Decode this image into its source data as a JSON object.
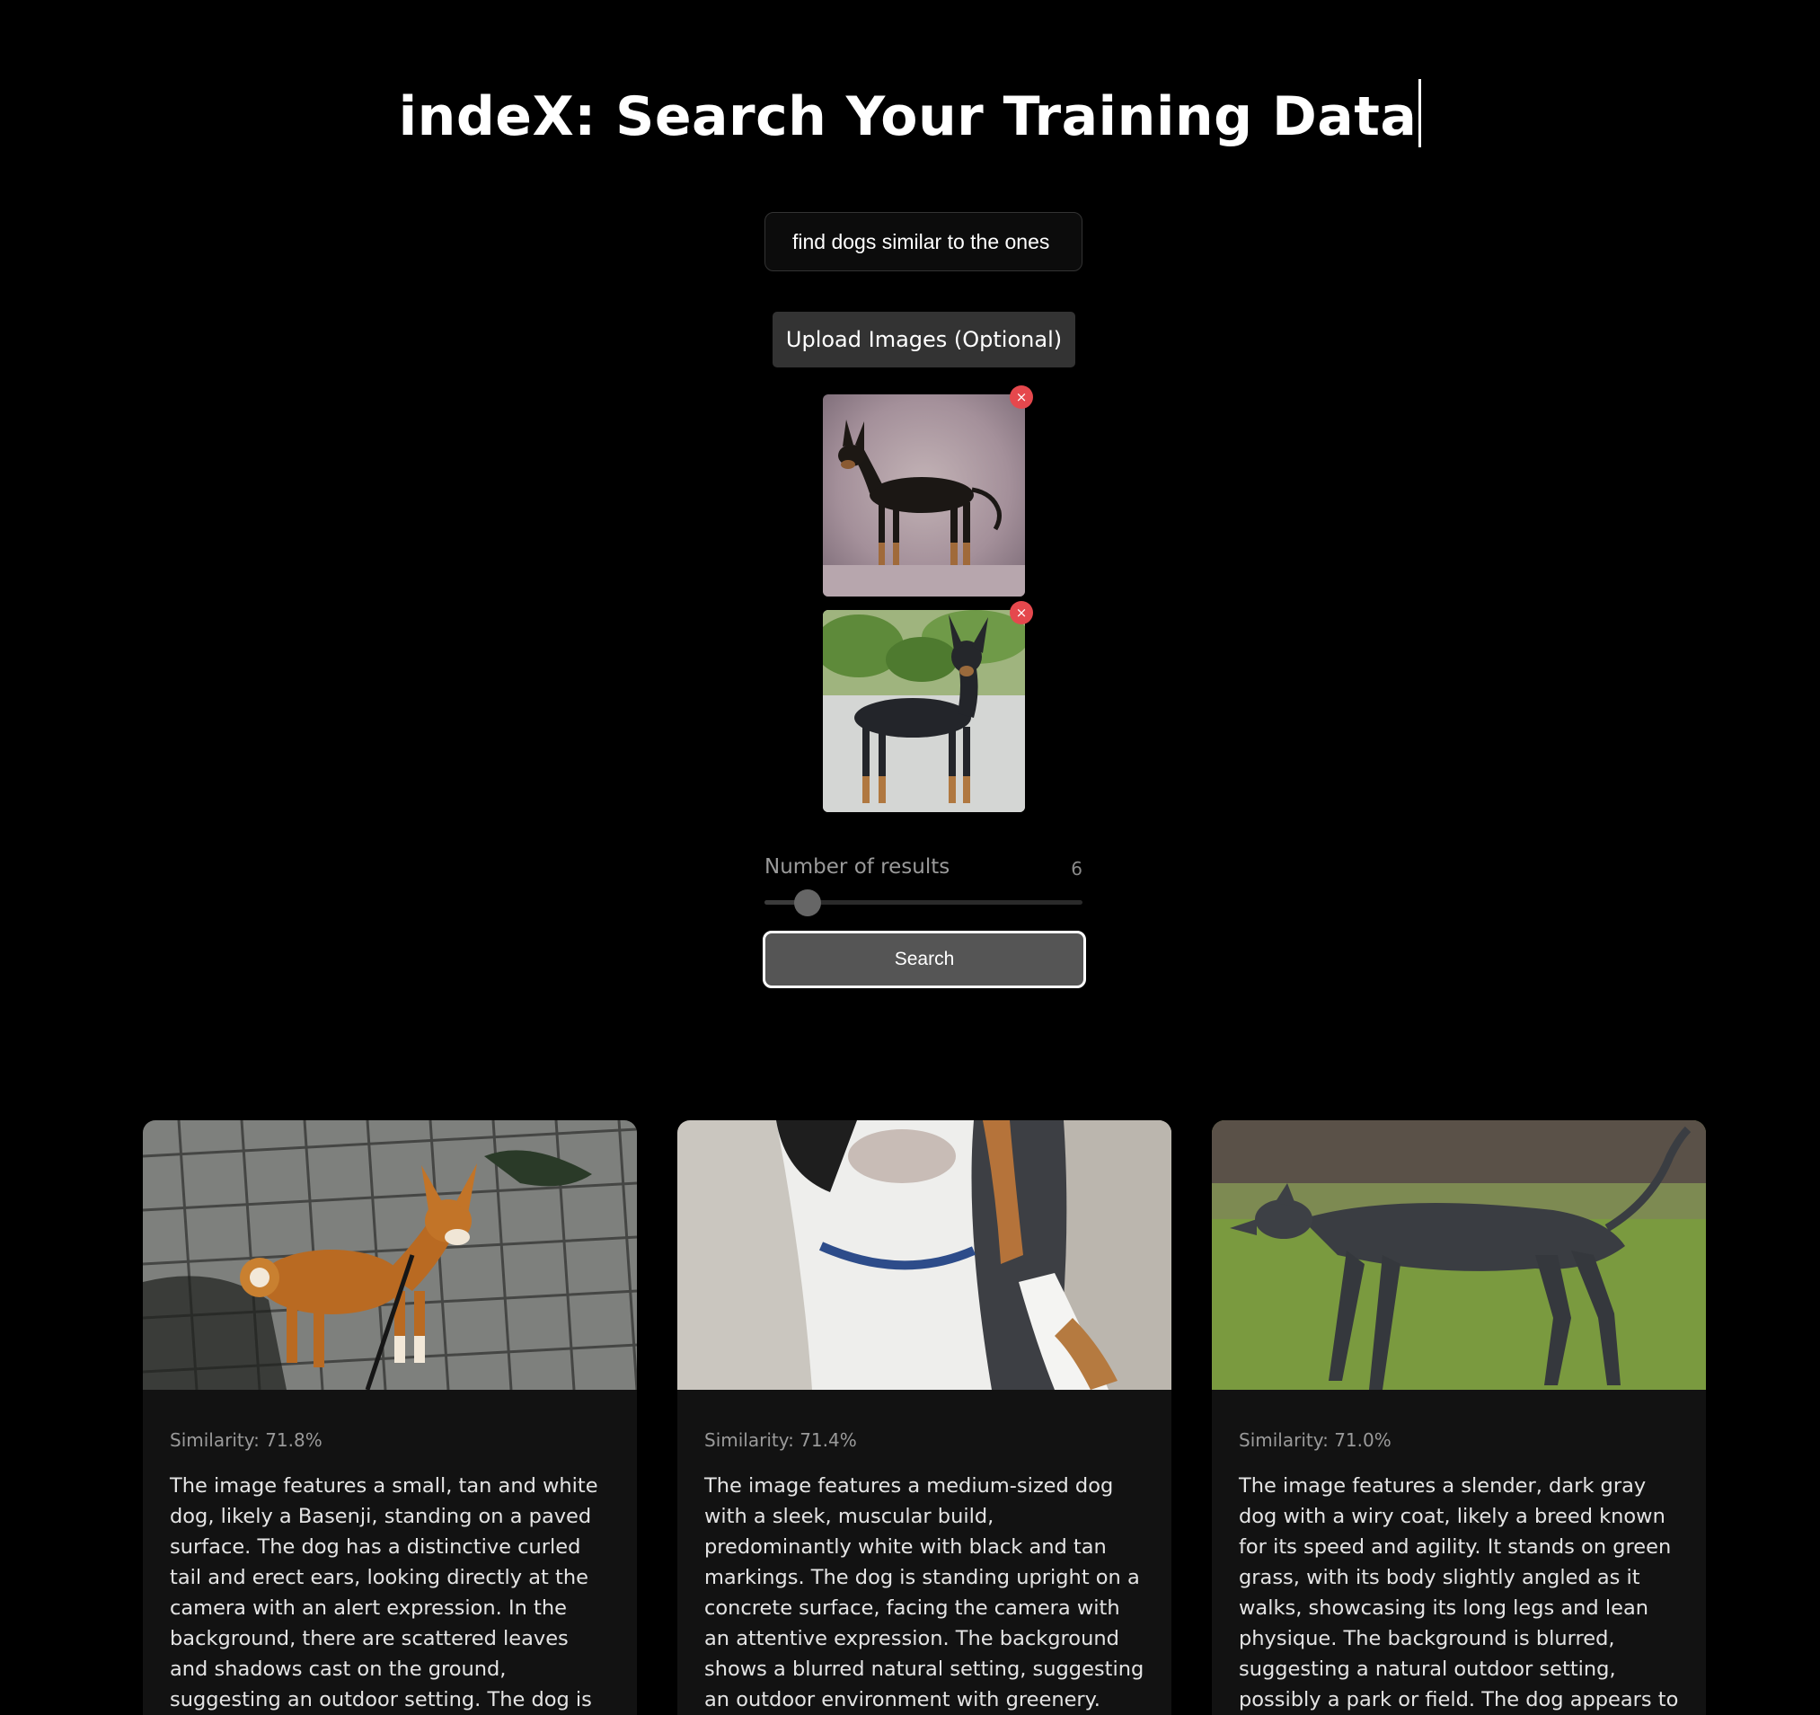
{
  "header": {
    "title": "indeX: Search Your Training Data"
  },
  "search": {
    "query_value": "find dogs similar to the ones",
    "search_button_label": "Search"
  },
  "upload": {
    "button_label": "Upload Images (Optional)",
    "remove_glyph": "×",
    "images": [
      {
        "subject": "black and tan toy terrier standing on a mottled studio backdrop"
      },
      {
        "subject": "black and tan toy terrier standing outdoors on pavement with trees behind"
      }
    ]
  },
  "slider": {
    "label": "Number of results",
    "value": "6",
    "min": 1,
    "max": 50,
    "current": 6
  },
  "results": [
    {
      "similarity": "Similarity: 71.8%",
      "description": "The image features a small, tan and white dog, likely a Basenji, standing on a paved surface. The dog has a distinctive curled tail and erect ears, looking directly at the camera with an alert expression. In the background, there are scattered leaves and shadows cast on the ground, suggesting an outdoor setting. The dog is wearing a harness and"
    },
    {
      "similarity": "Similarity: 71.4%",
      "description": "The image features a medium-sized dog with a sleek, muscular build, predominantly white with black and tan markings. The dog is standing upright on a concrete surface, facing the camera with an attentive expression. The background shows a blurred natural setting, suggesting an outdoor environment with greenery. There are no"
    },
    {
      "similarity": "Similarity: 71.0%",
      "description": "The image features a slender, dark gray dog with a wiry coat, likely a breed known for its speed and agility. It stands on green grass, with its body slightly angled as it walks, showcasing its long legs and lean physique. The background is blurred, suggesting a natural outdoor setting, possibly a park or field. The dog appears to be in motion, with"
    }
  ],
  "colors": {
    "background": "#000000",
    "card": "#121212",
    "remove": "#e5484d",
    "button": "#333333"
  }
}
